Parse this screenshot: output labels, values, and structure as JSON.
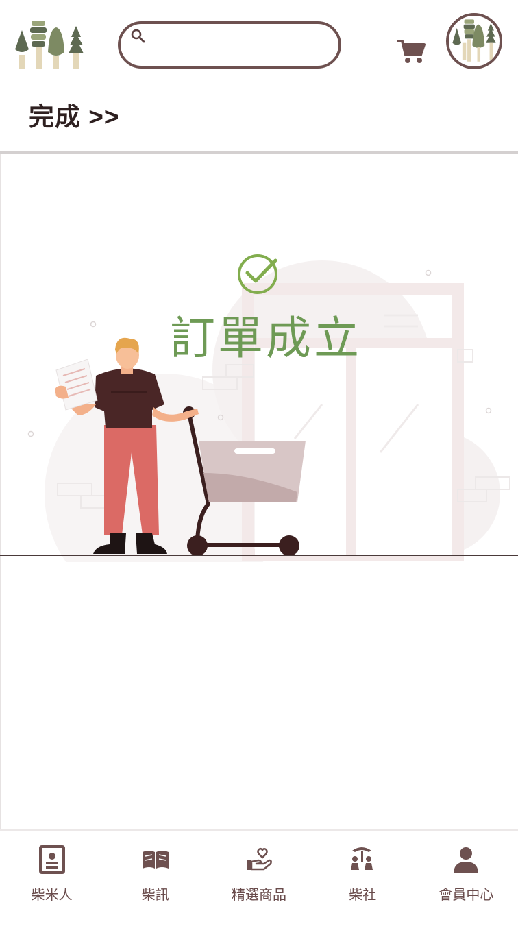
{
  "header": {
    "logo_icon": "trees-logo-icon",
    "search": {
      "placeholder": "",
      "value": "",
      "icon": "search-icon"
    },
    "cart_icon": "cart-icon",
    "avatar_icon": "trees-avatar-icon"
  },
  "breadcrumb": {
    "label": "完成 >>"
  },
  "success": {
    "icon": "check-circle-icon",
    "message": "訂單成立",
    "color": "#6e9a55"
  },
  "bottom_nav": {
    "items": [
      {
        "label": "柴米人",
        "icon": "profile-card-icon"
      },
      {
        "label": "柴訊",
        "icon": "open-book-icon"
      },
      {
        "label": "精選商品",
        "icon": "hand-heart-icon"
      },
      {
        "label": "柴社",
        "icon": "community-icon"
      },
      {
        "label": "會員中心",
        "icon": "person-icon"
      }
    ]
  },
  "colors": {
    "brand_brown": "#6e5150",
    "success_green": "#6e9a55"
  }
}
